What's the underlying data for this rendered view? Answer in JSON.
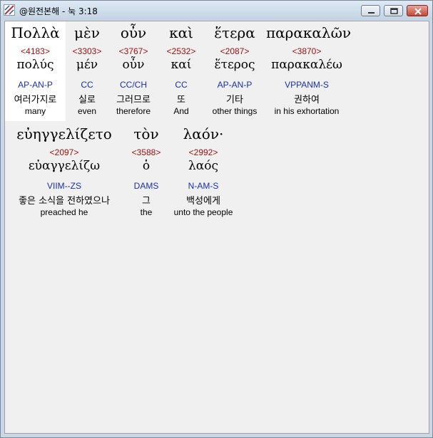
{
  "window": {
    "title": "@원전본해 - 눅 3:18",
    "buttons": {
      "minimize": "minimize",
      "maximize": "maximize",
      "close": "close"
    }
  },
  "colors": {
    "strong": "#a01010",
    "morph": "#1a2fb0",
    "selected_bg": "#ffffff",
    "client_bg": "#f0f0f0"
  },
  "rows": [
    [
      {
        "greek": "Πολλὰ",
        "strong": "<4183>",
        "lemma": "πολύς",
        "morph": "AP-AN-P",
        "korean": "여러가지로",
        "english": "many",
        "selected": true
      },
      {
        "greek": "μὲν",
        "strong": "<3303>",
        "lemma": "μέν",
        "morph": "CC",
        "korean": "실로",
        "english": "even"
      },
      {
        "greek": "οὖν",
        "strong": "<3767>",
        "lemma": "οὖν",
        "morph": "CC/CH",
        "korean": "그러므로",
        "english": "therefore"
      },
      {
        "greek": "καὶ",
        "strong": "<2532>",
        "lemma": "καί",
        "morph": "CC",
        "korean": "또",
        "english": "And"
      },
      {
        "greek": "ἕτερα",
        "strong": "<2087>",
        "lemma": "ἕτερος",
        "morph": "AP-AN-P",
        "korean": "기타",
        "english": "other things"
      },
      {
        "greek": "παρακαλῶν",
        "strong": "<3870>",
        "lemma": "παρακαλέω",
        "morph": "VPPANM-S",
        "korean": "권하여",
        "english": "in his exhortation"
      }
    ],
    [
      {
        "greek": "εὐηγγελίζετο",
        "strong": "<2097>",
        "lemma": "εὐαγγελίζω",
        "morph": "VIIM--ZS",
        "korean": "좋은 소식을 전하였으나",
        "english": "preached he"
      },
      {
        "greek": "τὸν",
        "strong": "<3588>",
        "lemma": "ὁ",
        "morph": "DAMS",
        "korean": "그",
        "english": "the"
      },
      {
        "greek": "λαόν·",
        "strong": "<2992>",
        "lemma": "λαός",
        "morph": "N-AM-S",
        "korean": "백성에게",
        "english": "unto the people"
      }
    ]
  ]
}
